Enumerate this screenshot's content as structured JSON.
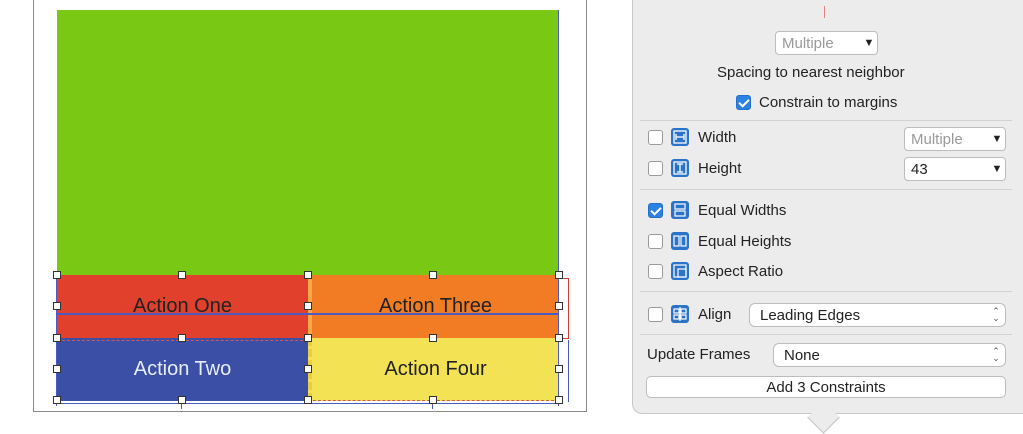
{
  "canvas": {
    "buttons": [
      {
        "id": "one",
        "label": "Action One"
      },
      {
        "id": "two",
        "label": "Action Two"
      },
      {
        "id": "three",
        "label": "Action Three"
      },
      {
        "id": "four",
        "label": "Action Four"
      }
    ],
    "colors": {
      "green_view": "#78c814",
      "action_one": "#e0402c",
      "action_two": "#3b4fa7",
      "action_three": "#f27c24",
      "action_four": "#f3e254"
    }
  },
  "popover": {
    "spacing": {
      "value": "Multiple",
      "caption": "Spacing to nearest neighbor",
      "constrain_to_margins": {
        "label": "Constrain to margins",
        "checked": true
      }
    },
    "size": [
      {
        "label": "Width",
        "checked": false,
        "value": "Multiple",
        "icon": "width-icon"
      },
      {
        "label": "Height",
        "checked": false,
        "value": "43",
        "icon": "height-icon"
      }
    ],
    "equal": [
      {
        "label": "Equal Widths",
        "checked": true,
        "icon": "equal-widths-icon"
      },
      {
        "label": "Equal Heights",
        "checked": false,
        "icon": "equal-heights-icon"
      },
      {
        "label": "Aspect Ratio",
        "checked": false,
        "icon": "aspect-ratio-icon"
      }
    ],
    "align": {
      "label": "Align",
      "checked": false,
      "value": "Leading Edges",
      "icon": "align-icon"
    },
    "update_frames": {
      "label": "Update Frames",
      "value": "None"
    },
    "add_button": "Add 3 Constraints",
    "accent": "#2b82e2"
  }
}
